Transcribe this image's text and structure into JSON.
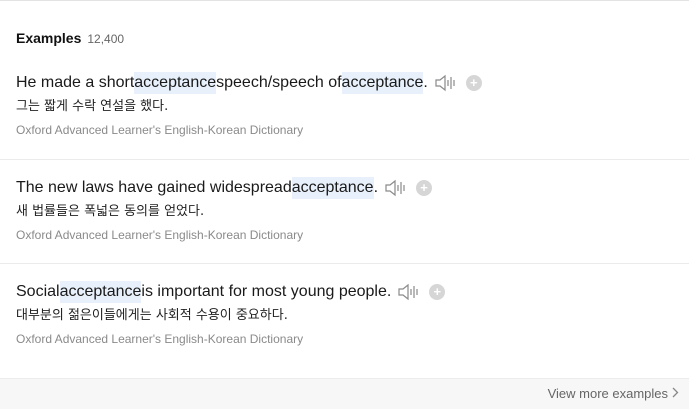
{
  "section": {
    "title": "Examples",
    "count": "12,400"
  },
  "examples": [
    {
      "parts": [
        {
          "text": "He made a short ",
          "hl": false
        },
        {
          "text": "acceptance",
          "hl": true
        },
        {
          "text": " speech/speech of ",
          "hl": false
        },
        {
          "text": "acceptance",
          "hl": true
        },
        {
          "text": ".",
          "hl": false
        }
      ],
      "translation": "그는 짧게 수락 연설을 했다.",
      "source": "Oxford Advanced Learner's English-Korean Dictionary",
      "speaker_icon": "speaker-icon",
      "add_icon": "plus-circle-icon"
    },
    {
      "parts": [
        {
          "text": "The new laws have gained widespread ",
          "hl": false
        },
        {
          "text": "acceptance",
          "hl": true
        },
        {
          "text": ".",
          "hl": false
        }
      ],
      "translation": "새 법률들은 폭넓은 동의를 얻었다.",
      "source": "Oxford Advanced Learner's English-Korean Dictionary",
      "speaker_icon": "speaker-icon",
      "add_icon": "plus-circle-icon"
    },
    {
      "parts": [
        {
          "text": "Social ",
          "hl": false
        },
        {
          "text": "acceptance",
          "hl": true
        },
        {
          "text": " is important for most young people.",
          "hl": false
        }
      ],
      "translation": "대부분의 젊은이들에게는 사회적 수용이 중요하다.",
      "source": "Oxford Advanced Learner's English-Korean Dictionary",
      "speaker_icon": "speaker-icon",
      "add_icon": "plus-circle-icon"
    }
  ],
  "footer": {
    "view_more_label": "View more examples",
    "chevron_icon": "chevron-right-icon"
  },
  "colors": {
    "highlight": "#e8f1fb",
    "footer_bg": "#f7f7f7",
    "source_text": "#8a8a8a"
  }
}
